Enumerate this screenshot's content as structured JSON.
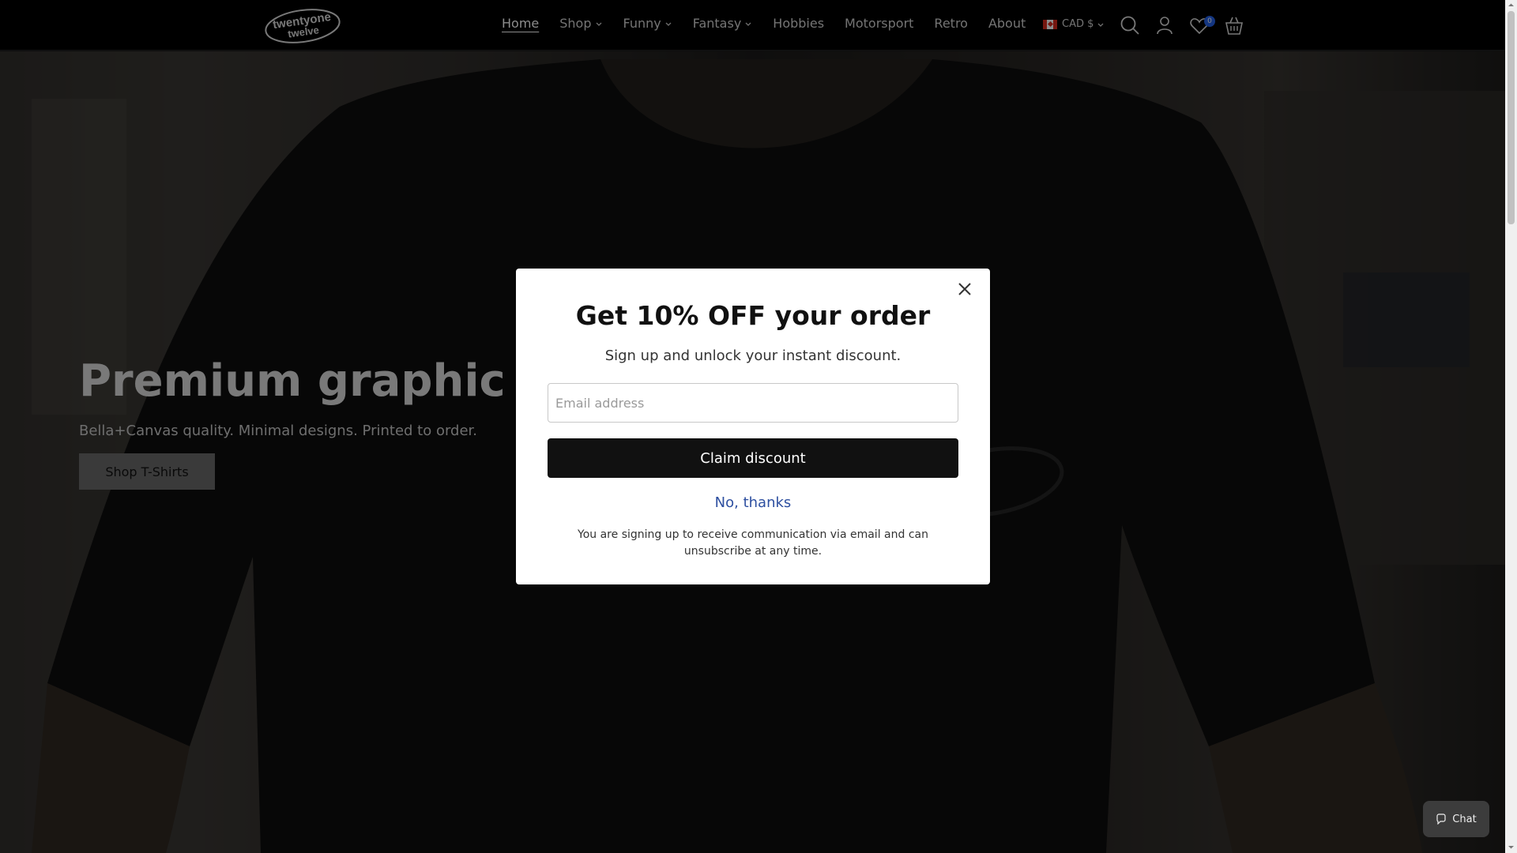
{
  "header": {
    "logo_text_top": "twentyone",
    "logo_text_bottom": "twelve",
    "nav": [
      {
        "label": "Home",
        "active": true,
        "dropdown": false
      },
      {
        "label": "Shop",
        "active": false,
        "dropdown": true
      },
      {
        "label": "Funny",
        "active": false,
        "dropdown": true
      },
      {
        "label": "Fantasy",
        "active": false,
        "dropdown": true
      },
      {
        "label": "Hobbies",
        "active": false,
        "dropdown": false
      },
      {
        "label": "Motorsport",
        "active": false,
        "dropdown": false
      },
      {
        "label": "Retro",
        "active": false,
        "dropdown": false
      },
      {
        "label": "About",
        "active": false,
        "dropdown": false
      }
    ],
    "currency": "CAD $",
    "icons": [
      "search-icon",
      "account-icon",
      "wishlist-icon",
      "cart-icon"
    ],
    "wishlist_count": "0"
  },
  "hero": {
    "title": "Premium graphic t-shi",
    "subtitle": "Bella+Canvas quality. Minimal designs. Printed to order.",
    "button_label": "Shop T-Shirts"
  },
  "modal": {
    "title": "Get 10% OFF your order",
    "subtitle": "Sign up and unlock your instant discount.",
    "email_placeholder": "Email address",
    "claim_label": "Claim discount",
    "decline_label": "No, thanks",
    "disclaimer": "You are signing up to receive communication via email and can unsubscribe at any time."
  },
  "chat": {
    "label": "Chat"
  },
  "colors": {
    "header_bg": "#000000",
    "accent_link": "#2d4fa0",
    "badge": "#2563eb"
  }
}
